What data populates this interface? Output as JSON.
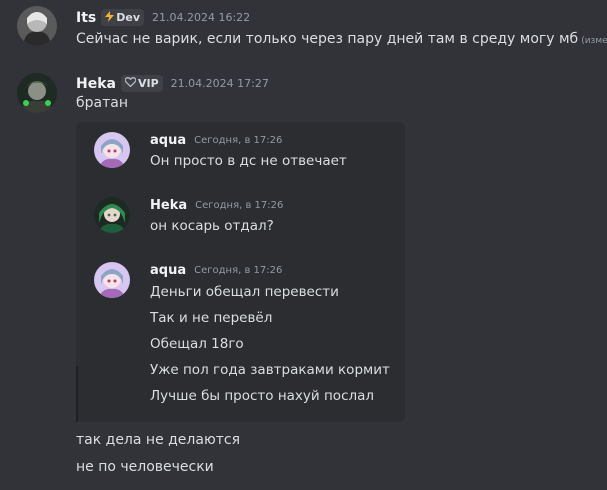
{
  "messages": [
    {
      "author": "Its",
      "badge": {
        "icon": "lightning-icon",
        "label": "Dev",
        "icon_color": "#f0b232"
      },
      "timestamp": "21.04.2024 16:22",
      "lines": [
        "Сейчас не варик, если только через пару дней там в среду могу мб"
      ],
      "edited_label": "(изменено)"
    },
    {
      "author": "Heka",
      "badge": {
        "icon": "heart-icon",
        "label": "VIP",
        "icon_color": "#b5bac1"
      },
      "timestamp": "21.04.2024 17:27",
      "lines": [
        "братан"
      ]
    }
  ],
  "forwarded": [
    {
      "author": "aqua",
      "timestamp": "Сегодня, в 17:26",
      "lines": [
        "Он просто в дс не отвечает"
      ]
    },
    {
      "author": "Heka",
      "timestamp": "Сегодня, в 17:26",
      "lines": [
        "он косарь отдал?"
      ]
    },
    {
      "author": "aqua",
      "timestamp": "Сегодня, в 17:26",
      "lines": [
        "Деньги обещал перевести",
        "Так и не перевёл",
        "Обещал 18го",
        "Уже пол года завтраками кормит",
        "Лучше бы просто нахуй послал"
      ]
    }
  ],
  "followups": [
    "так дела не делаются",
    "не по человечески"
  ],
  "colors": {
    "background": "#313338",
    "panel": "#2b2d31",
    "text": "#dbdee1",
    "muted": "#949ba4"
  }
}
